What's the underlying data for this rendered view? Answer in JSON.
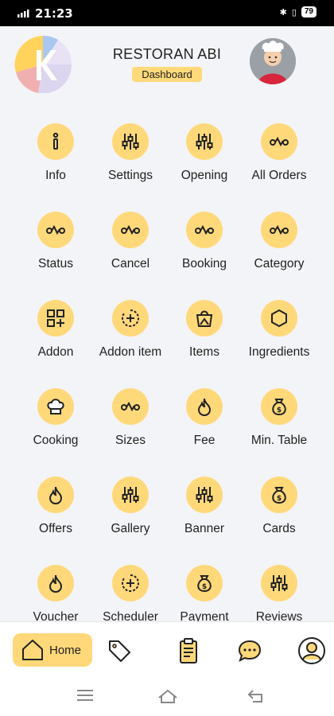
{
  "status_bar": {
    "time": "21:23",
    "battery": "79"
  },
  "header": {
    "title": "RESTORAN ABI",
    "badge": "Dashboard"
  },
  "menu": [
    {
      "label": "Info",
      "icon": "info-icon"
    },
    {
      "label": "Settings",
      "icon": "sliders-icon"
    },
    {
      "label": "Opening",
      "icon": "sliders-icon"
    },
    {
      "label": "All Orders",
      "icon": "route-icon"
    },
    {
      "label": "Status",
      "icon": "route-icon"
    },
    {
      "label": "Cancel",
      "icon": "route-icon"
    },
    {
      "label": "Booking",
      "icon": "route-icon"
    },
    {
      "label": "Category",
      "icon": "route-icon"
    },
    {
      "label": "Addon",
      "icon": "grid-plus-icon"
    },
    {
      "label": "Addon item",
      "icon": "circle-plus-icon"
    },
    {
      "label": "Items",
      "icon": "shopping-bag-icon"
    },
    {
      "label": "Ingredients",
      "icon": "hexagon-icon"
    },
    {
      "label": "Cooking",
      "icon": "chef-hat-icon"
    },
    {
      "label": "Sizes",
      "icon": "route-icon"
    },
    {
      "label": "Fee",
      "icon": "flame-icon"
    },
    {
      "label": "Min. Table",
      "icon": "money-bag-icon"
    },
    {
      "label": "Offers",
      "icon": "flame-icon"
    },
    {
      "label": "Gallery",
      "icon": "sliders-icon"
    },
    {
      "label": "Banner",
      "icon": "sliders-icon"
    },
    {
      "label": "Cards",
      "icon": "money-bag-icon"
    },
    {
      "label": "Voucher",
      "icon": "flame-icon"
    },
    {
      "label": "Scheduler",
      "icon": "circle-plus-icon"
    },
    {
      "label": "Payment",
      "icon": "money-bag-icon"
    },
    {
      "label": "Reviews",
      "icon": "sliders-icon"
    }
  ],
  "bottom_nav": {
    "home_label": "Home"
  },
  "colors": {
    "accent": "#ffd87a",
    "background": "#f3f4f7"
  }
}
